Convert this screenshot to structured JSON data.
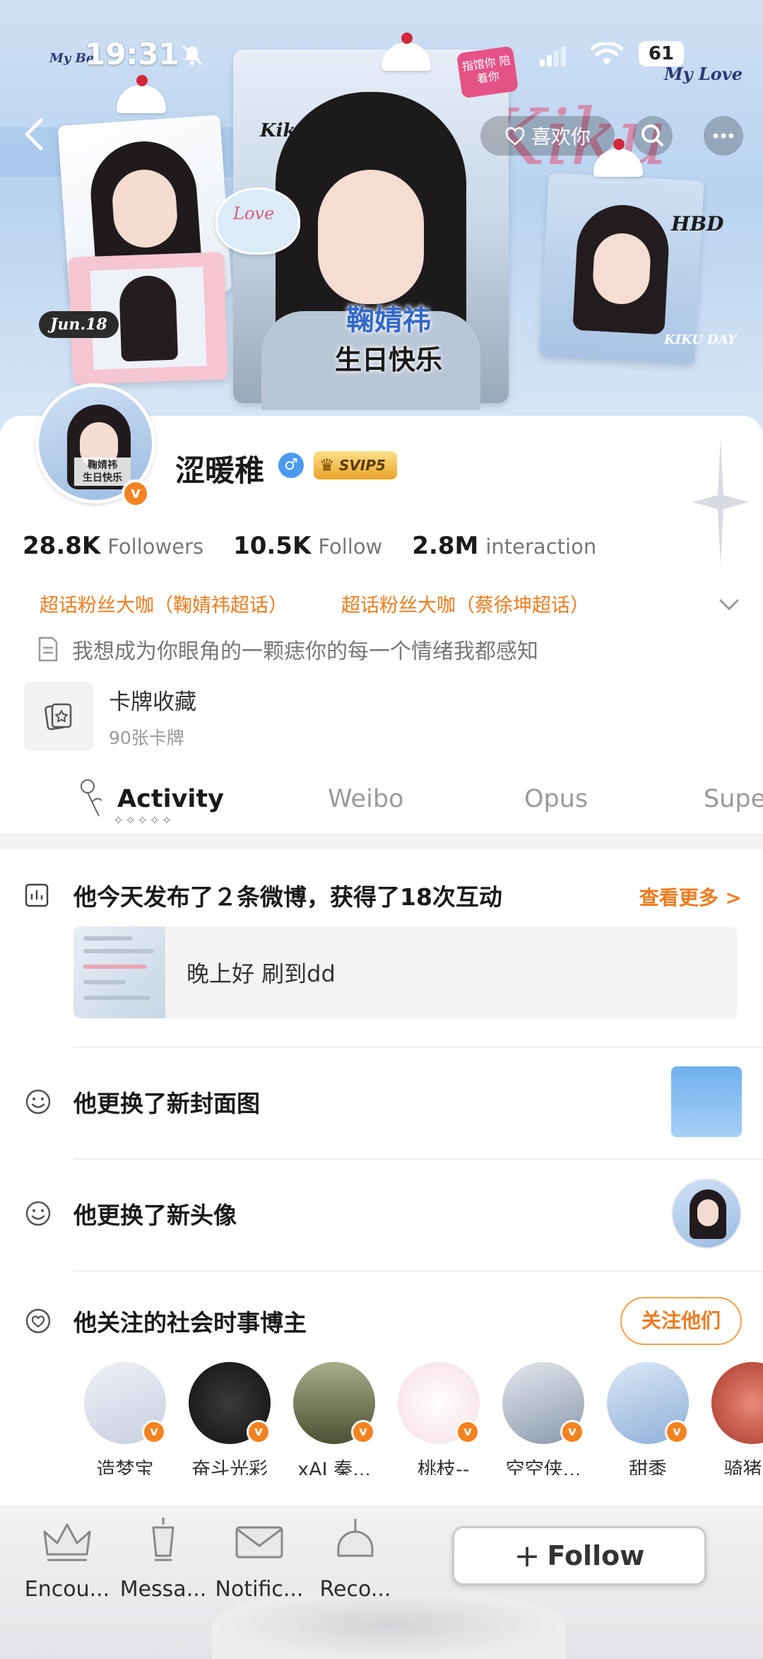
{
  "status_bar": {
    "time": "19:31",
    "battery": "61"
  },
  "banner": {
    "sticker_kiku": "Kiku",
    "sticker_love": "Love",
    "sticker_jun": "Jun.18",
    "sticker_hbd": "HBD",
    "sticker_kikuday": "KIKU DAY",
    "sticker_mylove": "My Love",
    "sticker_mybe": "My Be",
    "pink_badge": "指馆你 陪着你",
    "script_text": "Kiku",
    "title_line1": "鞠婧祎",
    "title_line2": "生日快乐"
  },
  "nav": {
    "like_label": "喜欢你"
  },
  "profile": {
    "avatar_caption_1": "鞠婧祎",
    "avatar_caption_2": "生日快乐",
    "verified_mark": "v",
    "username": "涩暖稚",
    "gender_mark": "♂",
    "vip_label": "SVIP5",
    "stats": [
      {
        "value": "28.8K",
        "label": "Followers"
      },
      {
        "value": "10.5K",
        "label": "Follow"
      },
      {
        "value": "2.8M",
        "label": "interaction"
      }
    ],
    "fan_tags": [
      "超话粉丝大咖（鞠婧祎超话）",
      "超话粉丝大咖（蔡徐坤超话）"
    ],
    "bio": "我想成为你眼角的一颗痣你的每一个情绪我都感知",
    "card_collection": {
      "title": "卡牌收藏",
      "subtitle": "90张卡牌"
    }
  },
  "tabs": {
    "activity": "Activity",
    "weibo": "Weibo",
    "opus": "Opus",
    "super": "Supe",
    "active": "Activity"
  },
  "feed": {
    "summary": "他今天发布了２条微博，获得了18次互动",
    "see_more": "查看更多 >",
    "post_preview_text": "晚上好 刷到dd",
    "cover_changed": "他更换了新封面图",
    "avatar_changed": "他更换了新头像",
    "followed_bloggers_title": "他关注的社会时事博主",
    "follow_them": "关注他们",
    "bloggers": [
      {
        "name": "造梦宝",
        "color": "#dfe3ee"
      },
      {
        "name": "奋斗光彩",
        "color": "#1c1c1e"
      },
      {
        "name": "xAI 秦...",
        "color": "#5d5f3a"
      },
      {
        "name": "_桃枝--",
        "color": "#f7e6ec"
      },
      {
        "name": "空空侠...",
        "color": "#b8c7d8"
      },
      {
        "name": "甜黍",
        "color": "#9fb6d9"
      },
      {
        "name": "骑猪少",
        "color": "#c44a3a"
      }
    ]
  },
  "bottom_nav": {
    "items": [
      "Encou...",
      "Messa...",
      "Notific...",
      "Reco..."
    ],
    "follow_button": "Follow"
  },
  "colors": {
    "accent": "#f07b1e",
    "verified": "#f58220",
    "vip_gold": "#e8a428",
    "male_blue": "#4a9af0"
  }
}
